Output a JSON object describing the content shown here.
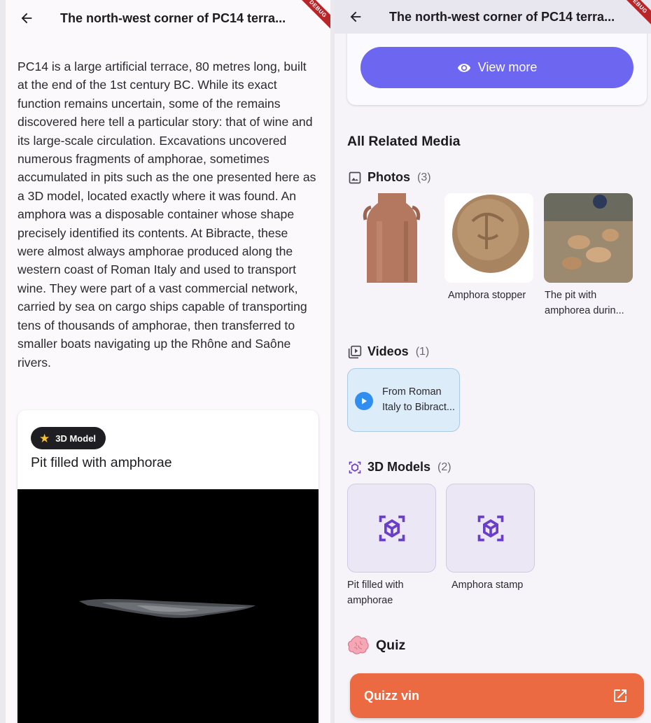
{
  "app": {
    "title": "The north-west corner of PC14 terra...",
    "debug_banner": "DEBUG"
  },
  "detail": {
    "description": "PC14 is a large artificial terrace, 80 metres long, built at the end of the 1st century BC. While its exact function remains uncertain, some of the remains discovered here tell a particular story: that of wine and its large-scale circulation. Excavations uncovered numerous fragments of amphorae, sometimes accumulated in pits such as the one presented here as a 3D model, located exactly where it was found. An amphora was a disposable container whose shape precisely identified its contents. At Bibracte, these were almost always amphorae produced along the western coast of Roman Italy and used to transport wine. They were part of a vast commercial network, carried by sea on cargo ships capable of transporting tens of thousands of amphorae, then transferred to smaller boats navigating up the Rhône and Saône rivers.",
    "model_card": {
      "chip_label": "3D Model",
      "title": "Pit filled with amphorae"
    }
  },
  "media": {
    "view_more_label": "View more",
    "heading": "All Related Media",
    "photos": {
      "label": "Photos",
      "count": "(3)",
      "items": [
        {
          "caption": ""
        },
        {
          "caption": "Amphora stopper"
        },
        {
          "caption": "The pit with amphorea durin..."
        }
      ]
    },
    "videos": {
      "label": "Videos",
      "count": "(1)",
      "items": [
        {
          "title": "From Roman Italy to Bibract..."
        }
      ]
    },
    "models": {
      "label": "3D Models",
      "count": "(2)",
      "items": [
        {
          "caption": "Pit filled with amphorae"
        },
        {
          "caption": "Amphora stamp"
        }
      ]
    },
    "quiz": {
      "heading": "Quiz",
      "button_label": "Quizz vin"
    }
  },
  "colors": {
    "primary": "#6c66f0",
    "quiz": "#ec6a41",
    "model_icon": "#6a3fc8",
    "video_card": "#dcecf8",
    "play": "#2f8ef0"
  }
}
